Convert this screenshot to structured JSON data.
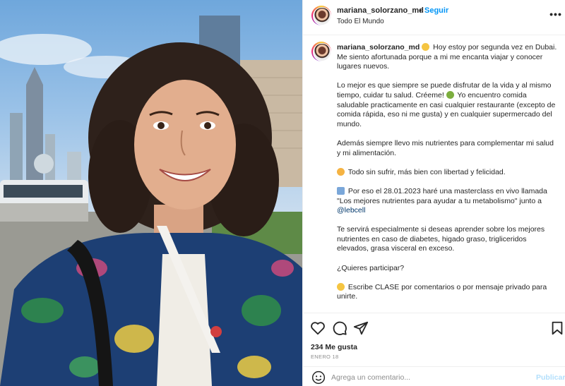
{
  "post": {
    "username": "mariana_solorzano_md",
    "separator": "•",
    "follow_label": "Seguir",
    "location": "Todo El Mundo",
    "more_icon": "more-horizontal-icon",
    "photo_description_icon": "post-photo"
  },
  "caption": {
    "author": "mariana_solorzano_md",
    "intro": "Hoy estoy por segunda vez en Dubai. Me siento afortunada porque a mi me encanta viajar y conocer lugares nuevos.",
    "p2": "Lo mejor es que siempre se puede disfrutar de la vida y al mismo tiempo, cuidar tu salud. Créeme!",
    "p2b": "Yo encuentro comida saludable practicamente en casi cualquier restaurante (excepto de comida rápida, eso ni me gusta) y en cualquier supermercado del mundo.",
    "p3": "Además siempre llevo mis nutrientes para complementar mi salud y mi alimentación.",
    "p4": "Todo sin sufrir, más bien con libertad y felicidad.",
    "p5": "Por eso el 28.01.2023 haré una masterclass en vivo llamada \"Los mejores nutrientes para ayudar a tu metabolismo\" junto a",
    "p5_mention": "@lebcell",
    "p6": "Te servirá especialmente si deseas aprender sobre los mejores nutrientes en caso de diabetes, higado graso, trigliceridos elevados, grasa visceral en exceso.",
    "p7": "¿Quieres participar?",
    "p8": "Escribe CLASE por comentarios o por mensaje privado para unirte."
  },
  "actions": {
    "like_icon": "heart-icon",
    "comment_icon": "comment-icon",
    "share_icon": "send-icon",
    "save_icon": "bookmark-icon",
    "likes": "234 Me gusta",
    "date": "ENERO 18"
  },
  "comment": {
    "placeholder": "Agrega un comentario...",
    "publish_label": "Publicar",
    "emoji_icon": "smiley-icon"
  },
  "colors": {
    "link_blue": "#0095f6",
    "publish_disabled": "#b2dffc",
    "mention": "#00376b"
  }
}
